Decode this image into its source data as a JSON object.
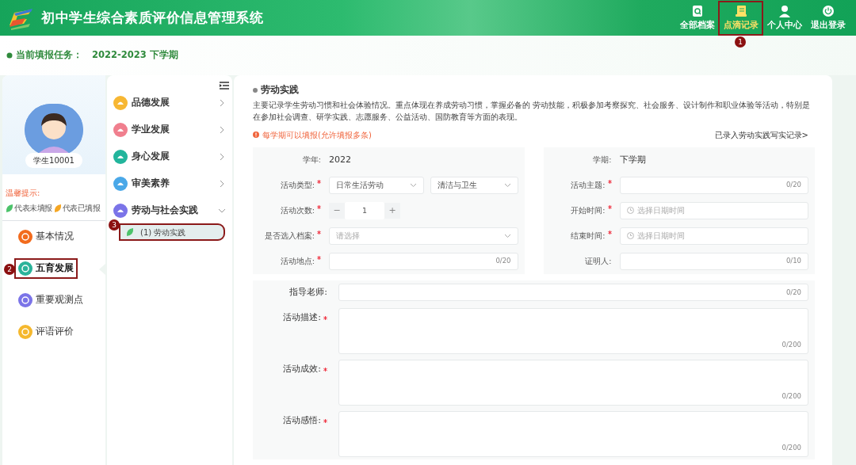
{
  "header": {
    "title": "初中学生综合素质评价信息管理系统",
    "nav": [
      {
        "label": "全部档案",
        "kind": "archive",
        "selected": false
      },
      {
        "label": "点滴记录",
        "kind": "scroll",
        "selected": true,
        "annotation": "1"
      },
      {
        "label": "个人中心",
        "kind": "person",
        "selected": false
      },
      {
        "label": "退出登录",
        "kind": "power",
        "selected": false
      }
    ]
  },
  "task": {
    "label": "当前填报任务：",
    "value": "2022-2023 下学期"
  },
  "profile": {
    "name": "学生10001"
  },
  "legend": {
    "title": "温馨提示:",
    "items": [
      {
        "label": "代表未填报",
        "color": "#4cc36a"
      },
      {
        "label": "代表已填报",
        "color": "#f5a623"
      }
    ]
  },
  "menu": [
    {
      "label": "基本情况",
      "color": "#f26b1d",
      "selected": false
    },
    {
      "label": "五育发展",
      "color": "#2bb39a",
      "selected": true,
      "annotation": "2"
    },
    {
      "label": "重要观测点",
      "color": "#7b74e8",
      "selected": false
    },
    {
      "label": "评语评价",
      "color": "#f5b82e",
      "selected": false
    }
  ],
  "submenu": [
    {
      "label": "品德发展",
      "color": "#f7b733",
      "expanded": false
    },
    {
      "label": "学业发展",
      "color": "#f07f8e",
      "expanded": false
    },
    {
      "label": "身心发展",
      "color": "#22b59c",
      "expanded": false
    },
    {
      "label": "审美素养",
      "color": "#4aa8e8",
      "expanded": false
    },
    {
      "label": "劳动与社会实践",
      "color": "#7b74e8",
      "expanded": true,
      "children": [
        {
          "label": "(1) 劳动实践",
          "selected": true,
          "annotation": "3"
        }
      ]
    }
  ],
  "form": {
    "title": "劳动实践",
    "description": "主要记录学生劳动习惯和社会体验情况。重点体现在养成劳动习惯，掌握必备的 劳动技能，积极参加考察探究、社会服务、设计制作和职业体验等活动，特别是在参加社会调查、研学实践、志愿服务、公益活动、国防教育等方面的表现。",
    "notice": "每学期可以填报(允许填报多条)",
    "records_link": "已录入劳动实践写实记录>",
    "pairs": [
      [
        {
          "label": "学年:",
          "kind": "static",
          "value": "2022",
          "required": false
        },
        {
          "label": "学期:",
          "kind": "static",
          "value": "下学期",
          "required": false
        }
      ],
      [
        {
          "label": "活动类型:",
          "kind": "select_pair",
          "values": [
            "日常生活劳动",
            "清洁与卫生"
          ],
          "required": true
        },
        {
          "label": "活动主题:",
          "kind": "input",
          "counter": "0/20",
          "required": true
        }
      ],
      [
        {
          "label": "活动次数:",
          "kind": "stepper",
          "minus": "−",
          "value": "1",
          "plus": "+",
          "required": true
        },
        {
          "label": "开始时间:",
          "kind": "datetime",
          "placeholder": "选择日期时间",
          "required": true
        }
      ],
      [
        {
          "label": "是否选入档案:",
          "kind": "select",
          "placeholder": "请选择",
          "required": true
        },
        {
          "label": "结束时间:",
          "kind": "datetime",
          "placeholder": "选择日期时间",
          "required": true
        }
      ],
      [
        {
          "label": "活动地点:",
          "kind": "input",
          "counter": "0/20",
          "required": true
        },
        {
          "label": "证明人:",
          "kind": "input",
          "counter": "0/10",
          "required": false
        }
      ]
    ],
    "full": [
      {
        "label": "指导老师:",
        "kind": "input",
        "counter": "0/20",
        "required": false
      },
      {
        "label": "活动描述:",
        "kind": "textarea",
        "counter": "0/200",
        "required": true
      },
      {
        "label": "活动成效:",
        "kind": "textarea",
        "counter": "0/200",
        "required": true
      },
      {
        "label": "活动感悟:",
        "kind": "textarea",
        "counter": "0/200",
        "required": true
      }
    ]
  }
}
